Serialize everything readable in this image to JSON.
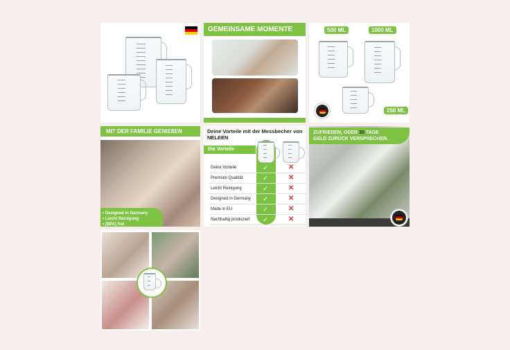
{
  "tiles": {
    "moments": {
      "title": "GEMEINSAME MOMENTE"
    },
    "sizes": {
      "size_500": "500 ML",
      "size_1000": "1000 ML",
      "size_250": "250 ML"
    },
    "family": {
      "title": "MIT DER FAMILIE GENIEßEN",
      "bullets": [
        "• Designed in Germany",
        "• Leicht Reinigung",
        "• (BPA) frei"
      ]
    },
    "benefits": {
      "headline": "Deine Vorteile mit der Messbecher von NELEEN",
      "tab": "Die Vorteile",
      "rows": [
        "Deine Vorteile",
        "Premium Qualität",
        "Leicht Reinigung",
        "Designed in Germany",
        "Made in EU",
        "Nachhaltig produziert"
      ]
    },
    "guarantee": {
      "line1_a": "ZUFRIEDEN, ODER ",
      "line1_num": "30",
      "line1_b": " TAGE",
      "line2": "GELD ZURÜCK VERSPRECHEN."
    }
  },
  "icons": {
    "check": "✓",
    "cross": "✕"
  },
  "colors": {
    "accent": "#7dc242",
    "background": "#f7eeee",
    "cross": "#d33333"
  }
}
